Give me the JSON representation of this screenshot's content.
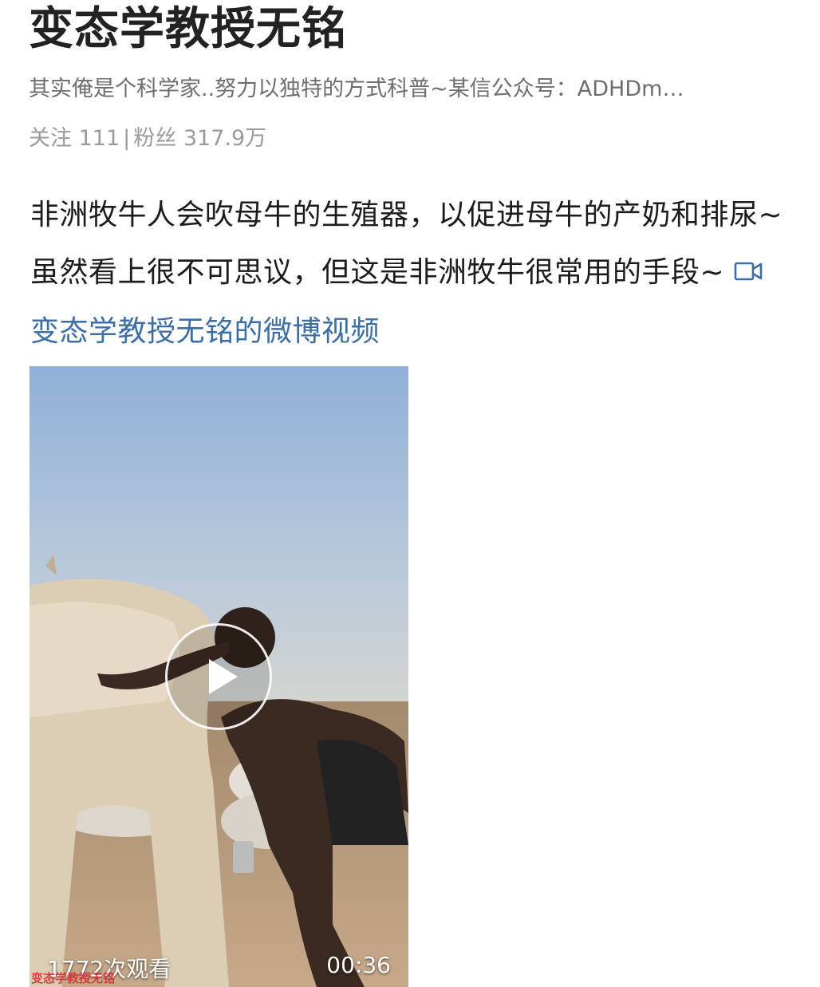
{
  "profile": {
    "name": "变态学教授无铭",
    "bio": "其实俺是个科学家..努力以独特的方式科普~某信公众号：ADHDm…",
    "follow_label": "关注",
    "follow_count": "111",
    "separator": "|",
    "fans_label": "粉丝",
    "fans_count": "317.9万"
  },
  "post": {
    "text": "非洲牧牛人会吹母牛的生殖器，以促进母牛的产奶和排尿~虽然看上很不可思议，但这是非洲牧牛很常用的手段~ ",
    "video_link_text": "变态学教授无铭的微博视频",
    "video_link_icon": "video-camera-icon",
    "link_color": "#3c6ea5"
  },
  "video": {
    "view_count": "1772次观看",
    "duration": "00:36",
    "watermark": "变态学教授无铭",
    "play_icon": "play-icon"
  }
}
